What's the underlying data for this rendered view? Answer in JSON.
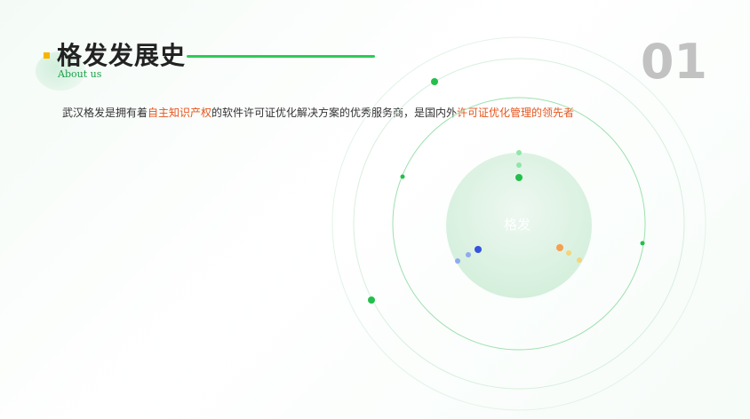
{
  "header": {
    "title": "格发发展史",
    "subtitle": "About us",
    "page_number": "01"
  },
  "description": {
    "part1": "武汉格发是拥有着",
    "highlight1": "自主知识产权",
    "part2": "的软件许可证优化解决方案的优秀服务商，是国内外",
    "highlight2": "许可证优化管理的领先者"
  },
  "orbit": {
    "center_label": "格发"
  },
  "colors": {
    "accent_green": "#2ccc55",
    "highlight": "#e8541d",
    "accent_yellow": "#f7b500",
    "page_number": "#c2c2c2"
  }
}
